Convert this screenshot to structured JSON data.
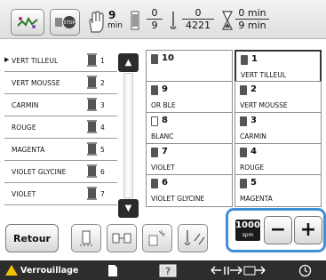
{
  "status": {
    "stitches_count": "9",
    "stitches_unit": "min",
    "color_frac_top": "0",
    "color_frac_bottom": "9",
    "stitch_frac_top": "0",
    "stitch_frac_bottom": "4221",
    "time_frac_top": "0 min",
    "time_frac_bottom": "9 min"
  },
  "thread_list": [
    {
      "name": "VERT TILLEUL",
      "num": "1",
      "active": true
    },
    {
      "name": "VERT MOUSSE",
      "num": "2",
      "active": false
    },
    {
      "name": "CARMIN",
      "num": "3",
      "active": false
    },
    {
      "name": "ROUGE",
      "num": "4",
      "active": false
    },
    {
      "name": "MAGENTA",
      "num": "5",
      "active": false
    },
    {
      "name": "VIOLET GLYCINE",
      "num": "6",
      "active": false
    },
    {
      "name": "VIOLET",
      "num": "7",
      "active": false
    }
  ],
  "grid": [
    {
      "num": "10",
      "name": "",
      "white": false
    },
    {
      "num": "1",
      "name": "VERT TILLEUL",
      "white": false,
      "selected": true
    },
    {
      "num": "9",
      "name": "OR BLE",
      "white": false
    },
    {
      "num": "2",
      "name": "VERT MOUSSE",
      "white": false
    },
    {
      "num": "8",
      "name": "BLANC",
      "white": true
    },
    {
      "num": "3",
      "name": "CARMIN",
      "white": false
    },
    {
      "num": "7",
      "name": "VIOLET",
      "white": false
    },
    {
      "num": "4",
      "name": "ROUGE",
      "white": false
    },
    {
      "num": "6",
      "name": "VIOLET GLYCINE",
      "white": false
    },
    {
      "num": "5",
      "name": "MAGENTA",
      "white": false
    }
  ],
  "controls": {
    "retour_label": "Retour",
    "speed_value": "1000",
    "speed_unit": "spm",
    "minus_label": "−",
    "plus_label": "+"
  },
  "bottombar": {
    "lock_label": "Verrouillage"
  },
  "colors": {
    "highlight": "#3f8fd8",
    "bar_dark": "#2d2d2d",
    "warning": "#f2c200"
  }
}
